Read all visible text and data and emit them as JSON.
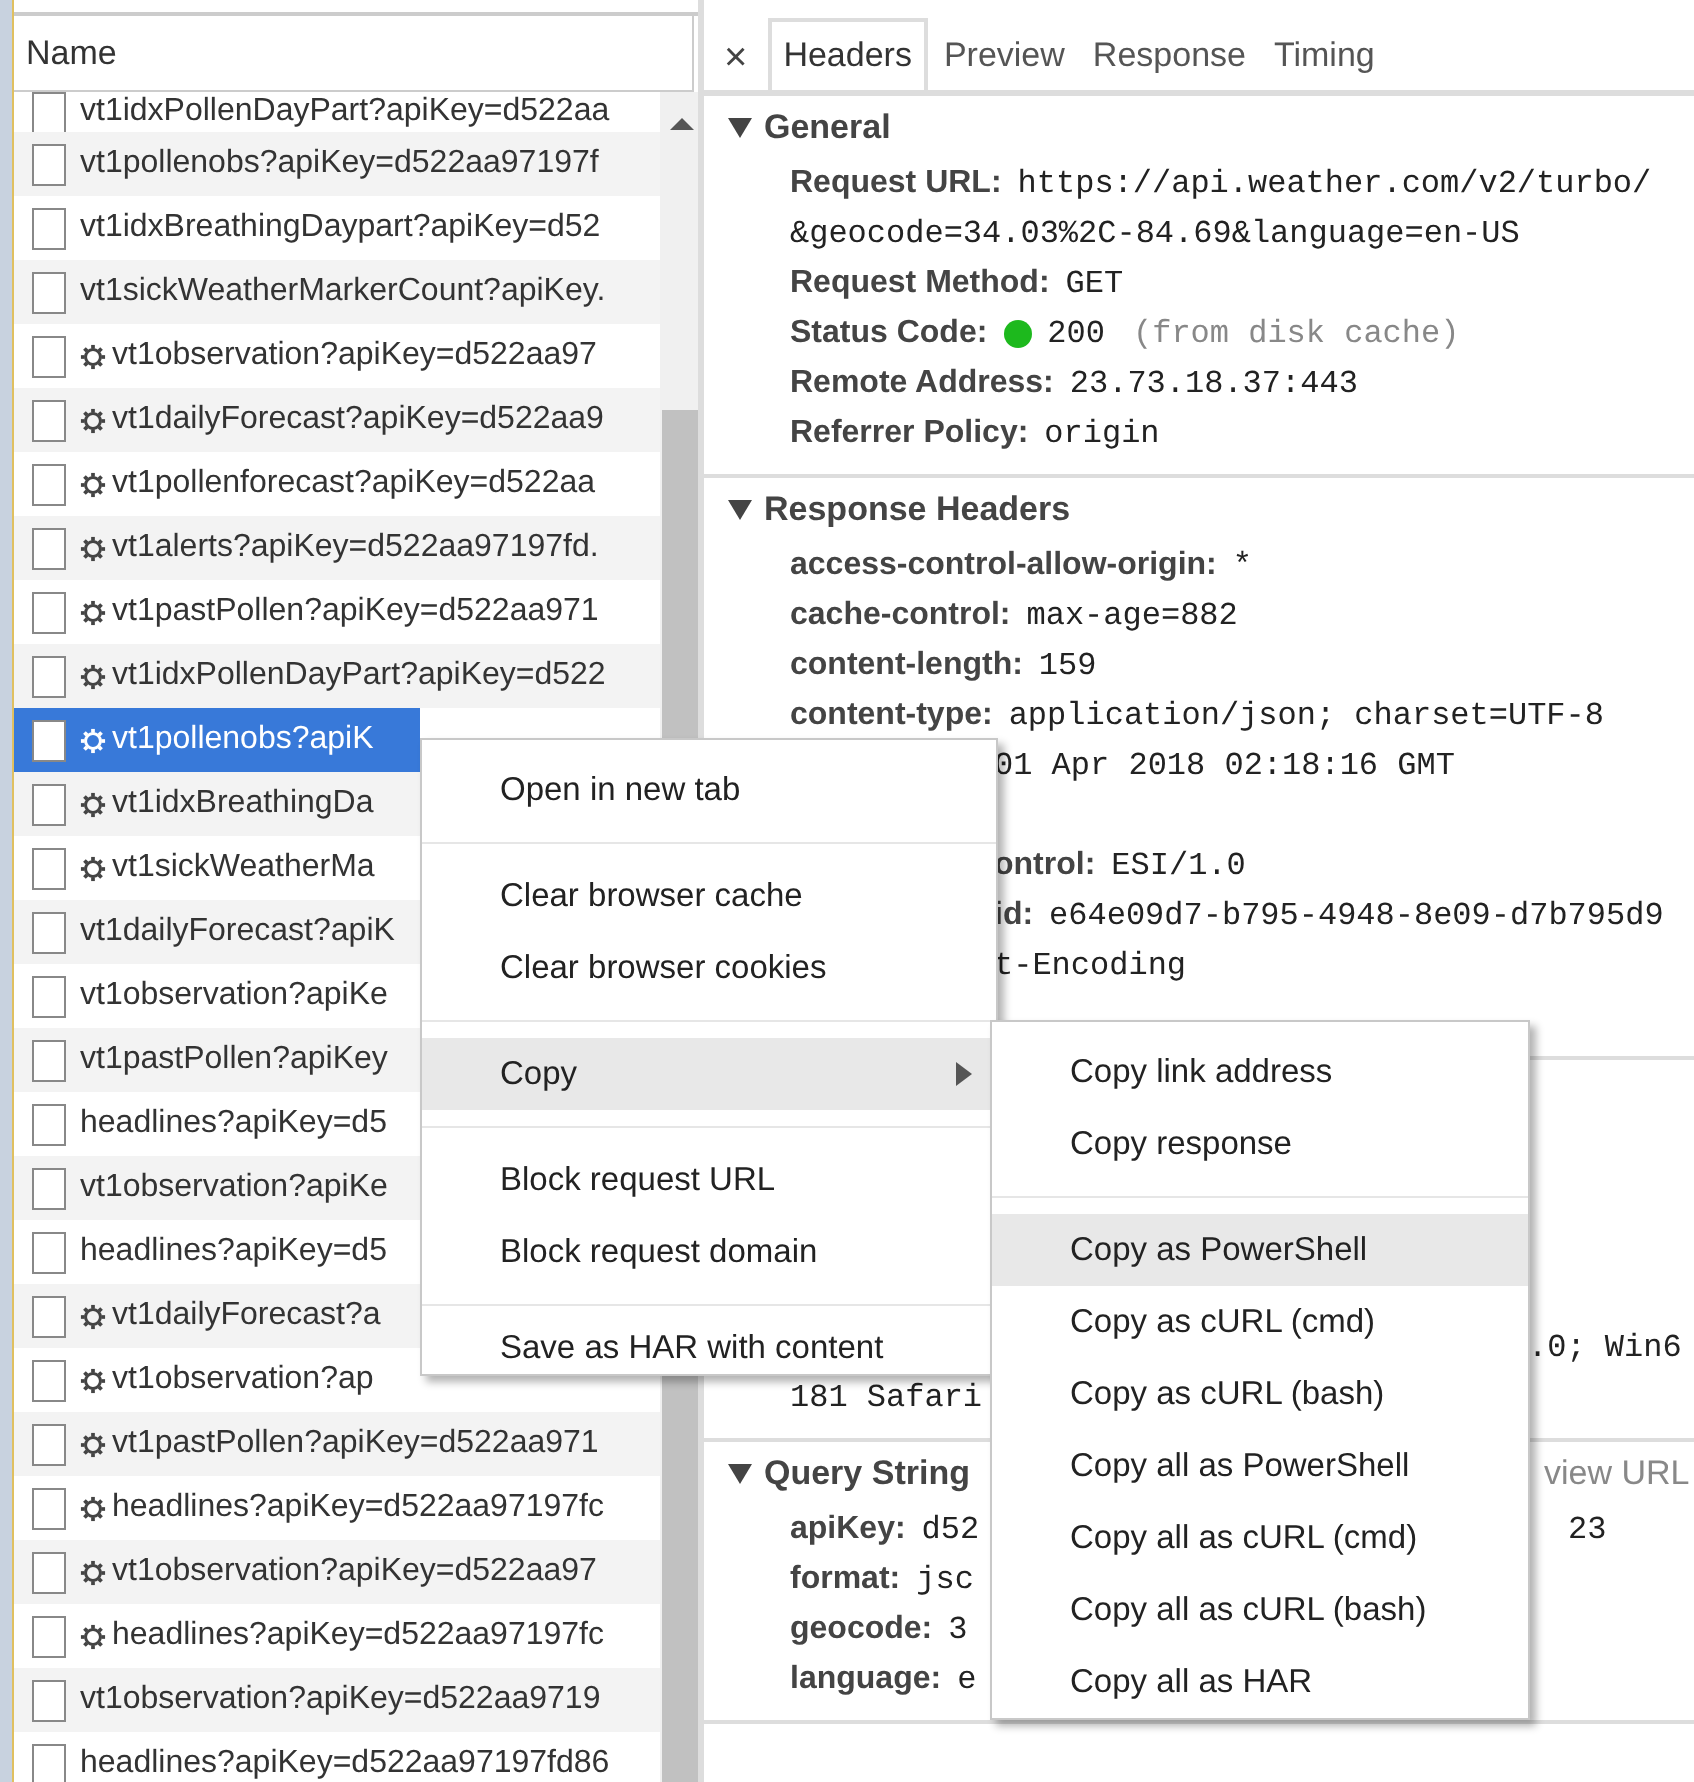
{
  "list_header": "Name",
  "requests": [
    {
      "text": "vt1idxPollenDayPart?apiKey=d522aa",
      "gear": false,
      "selected": false
    },
    {
      "text": "vt1pollenobs?apiKey=d522aa97197f",
      "gear": false,
      "selected": false
    },
    {
      "text": "vt1idxBreathingDaypart?apiKey=d52",
      "gear": false,
      "selected": false
    },
    {
      "text": "vt1sickWeatherMarkerCount?apiKey.",
      "gear": false,
      "selected": false
    },
    {
      "text": "vt1observation?apiKey=d522aa97",
      "gear": true,
      "selected": false
    },
    {
      "text": "vt1dailyForecast?apiKey=d522aa9",
      "gear": true,
      "selected": false
    },
    {
      "text": "vt1pollenforecast?apiKey=d522aa",
      "gear": true,
      "selected": false
    },
    {
      "text": "vt1alerts?apiKey=d522aa97197fd.",
      "gear": true,
      "selected": false
    },
    {
      "text": "vt1pastPollen?apiKey=d522aa971",
      "gear": true,
      "selected": false
    },
    {
      "text": "vt1idxPollenDayPart?apiKey=d522",
      "gear": true,
      "selected": false
    },
    {
      "text": "vt1pollenobs?apiK",
      "gear": true,
      "selected": true
    },
    {
      "text": "vt1idxBreathingDa",
      "gear": true,
      "selected": false
    },
    {
      "text": "vt1sickWeatherMa",
      "gear": true,
      "selected": false
    },
    {
      "text": "vt1dailyForecast?apiK",
      "gear": false,
      "selected": false
    },
    {
      "text": "vt1observation?apiKe",
      "gear": false,
      "selected": false
    },
    {
      "text": "vt1pastPollen?apiKey",
      "gear": false,
      "selected": false
    },
    {
      "text": "headlines?apiKey=d5",
      "gear": false,
      "selected": false
    },
    {
      "text": "vt1observation?apiKe",
      "gear": false,
      "selected": false
    },
    {
      "text": "headlines?apiKey=d5",
      "gear": false,
      "selected": false
    },
    {
      "text": "vt1dailyForecast?a",
      "gear": true,
      "selected": false
    },
    {
      "text": "vt1observation?ap",
      "gear": true,
      "selected": false
    },
    {
      "text": "vt1pastPollen?apiKey=d522aa971",
      "gear": true,
      "selected": false
    },
    {
      "text": "headlines?apiKey=d522aa97197fc",
      "gear": true,
      "selected": false
    },
    {
      "text": "vt1observation?apiKey=d522aa97",
      "gear": true,
      "selected": false
    },
    {
      "text": "headlines?apiKey=d522aa97197fc",
      "gear": true,
      "selected": false
    },
    {
      "text": "vt1observation?apiKey=d522aa9719",
      "gear": false,
      "selected": false
    },
    {
      "text": "headlines?apiKey=d522aa97197fd86",
      "gear": false,
      "selected": false
    }
  ],
  "close_button": "×",
  "tabs": [
    {
      "label": "Headers",
      "selected": true
    },
    {
      "label": "Preview",
      "selected": false
    },
    {
      "label": "Response",
      "selected": false
    },
    {
      "label": "Timing",
      "selected": false
    }
  ],
  "sections": [
    {
      "title": "General",
      "expanded": true,
      "rows": [
        {
          "kind": "full",
          "key": "Request URL:",
          "value": "https://api.weather.com/v2/turbo/",
          "continuation": "&geocode=34.03%2C-84.69&language=en-US"
        },
        {
          "kind": "full",
          "key": "Request Method:",
          "value": "GET"
        },
        {
          "kind": "status",
          "key": "Status Code:",
          "color": "#1db91d",
          "value": "200",
          "note": "(from disk cache)"
        },
        {
          "kind": "full",
          "key": "Remote Address:",
          "value": "23.73.18.37:443"
        },
        {
          "kind": "full",
          "key": "Referrer Policy:",
          "value": "origin"
        }
      ]
    },
    {
      "title": "Response Headers",
      "expanded": true,
      "rows": [
        {
          "kind": "full",
          "key": "access-control-allow-origin:",
          "value": "*"
        },
        {
          "kind": "full",
          "key": "cache-control:",
          "value": "max-age=882"
        },
        {
          "kind": "full",
          "key": "content-length:",
          "value": "159"
        },
        {
          "kind": "full",
          "key": "content-type:",
          "value": "application/json; charset=UTF-8"
        },
        {
          "kind": "after_menu",
          "value": "01 Apr 2018 02:18:16 GMT"
        },
        {
          "kind": "covered"
        },
        {
          "kind": "after_menu",
          "key": "ontrol:",
          "value": "ESI/1.0"
        },
        {
          "kind": "after_menu",
          "key": "id:",
          "value": "e64e09d7-b795-4948-8e09-d7b795d9"
        },
        {
          "kind": "after_menu",
          "value": "t-Encoding"
        },
        {
          "kind": "covered"
        }
      ]
    },
    {
      "rows": [
        {
          "kind": "covered"
        },
        {
          "kind": "covered"
        },
        {
          "kind": "covered"
        },
        {
          "kind": "covered"
        },
        {
          "kind": "after_submenu",
          "value": ".0; Win6"
        },
        {
          "kind": "full",
          "value": "181 Safari"
        }
      ]
    },
    {
      "title": "Query String",
      "expanded": true,
      "link": "view URL",
      "rows": [
        {
          "kind": "full",
          "key": "apiKey:",
          "value": "d52",
          "tail": "23"
        },
        {
          "kind": "full",
          "key": "format:",
          "value": "jsc"
        },
        {
          "kind": "full",
          "key": "geocode:",
          "value": "3"
        },
        {
          "kind": "full",
          "key": "language:",
          "value": "e"
        }
      ]
    }
  ],
  "context_menu": [
    {
      "kind": "item",
      "label": "Open in new tab",
      "selected": false
    },
    {
      "kind": "separator"
    },
    {
      "kind": "item",
      "label": "Clear browser cache",
      "selected": false
    },
    {
      "kind": "item",
      "label": "Clear browser cookies",
      "selected": false
    },
    {
      "kind": "separator"
    },
    {
      "kind": "submenu",
      "label": "Copy",
      "selected": true
    },
    {
      "kind": "separator"
    },
    {
      "kind": "item",
      "label": "Block request URL",
      "selected": false
    },
    {
      "kind": "item",
      "label": "Block request domain",
      "selected": false
    },
    {
      "kind": "separator"
    },
    {
      "kind": "item",
      "label": "Save as HAR with content",
      "selected": false
    }
  ],
  "submenu": [
    {
      "kind": "item",
      "label": "Copy link address",
      "selected": false
    },
    {
      "kind": "item",
      "label": "Copy response",
      "selected": false
    },
    {
      "kind": "separator"
    },
    {
      "kind": "item",
      "label": "Copy as PowerShell",
      "selected": true
    },
    {
      "kind": "item",
      "label": "Copy as cURL (cmd)",
      "selected": false
    },
    {
      "kind": "item",
      "label": "Copy as cURL (bash)",
      "selected": false
    },
    {
      "kind": "item",
      "label": "Copy all as PowerShell",
      "selected": false
    },
    {
      "kind": "item",
      "label": "Copy all as cURL (cmd)",
      "selected": false
    },
    {
      "kind": "item",
      "label": "Copy all as cURL (bash)",
      "selected": false
    },
    {
      "kind": "item",
      "label": "Copy all as HAR",
      "selected": false
    }
  ]
}
